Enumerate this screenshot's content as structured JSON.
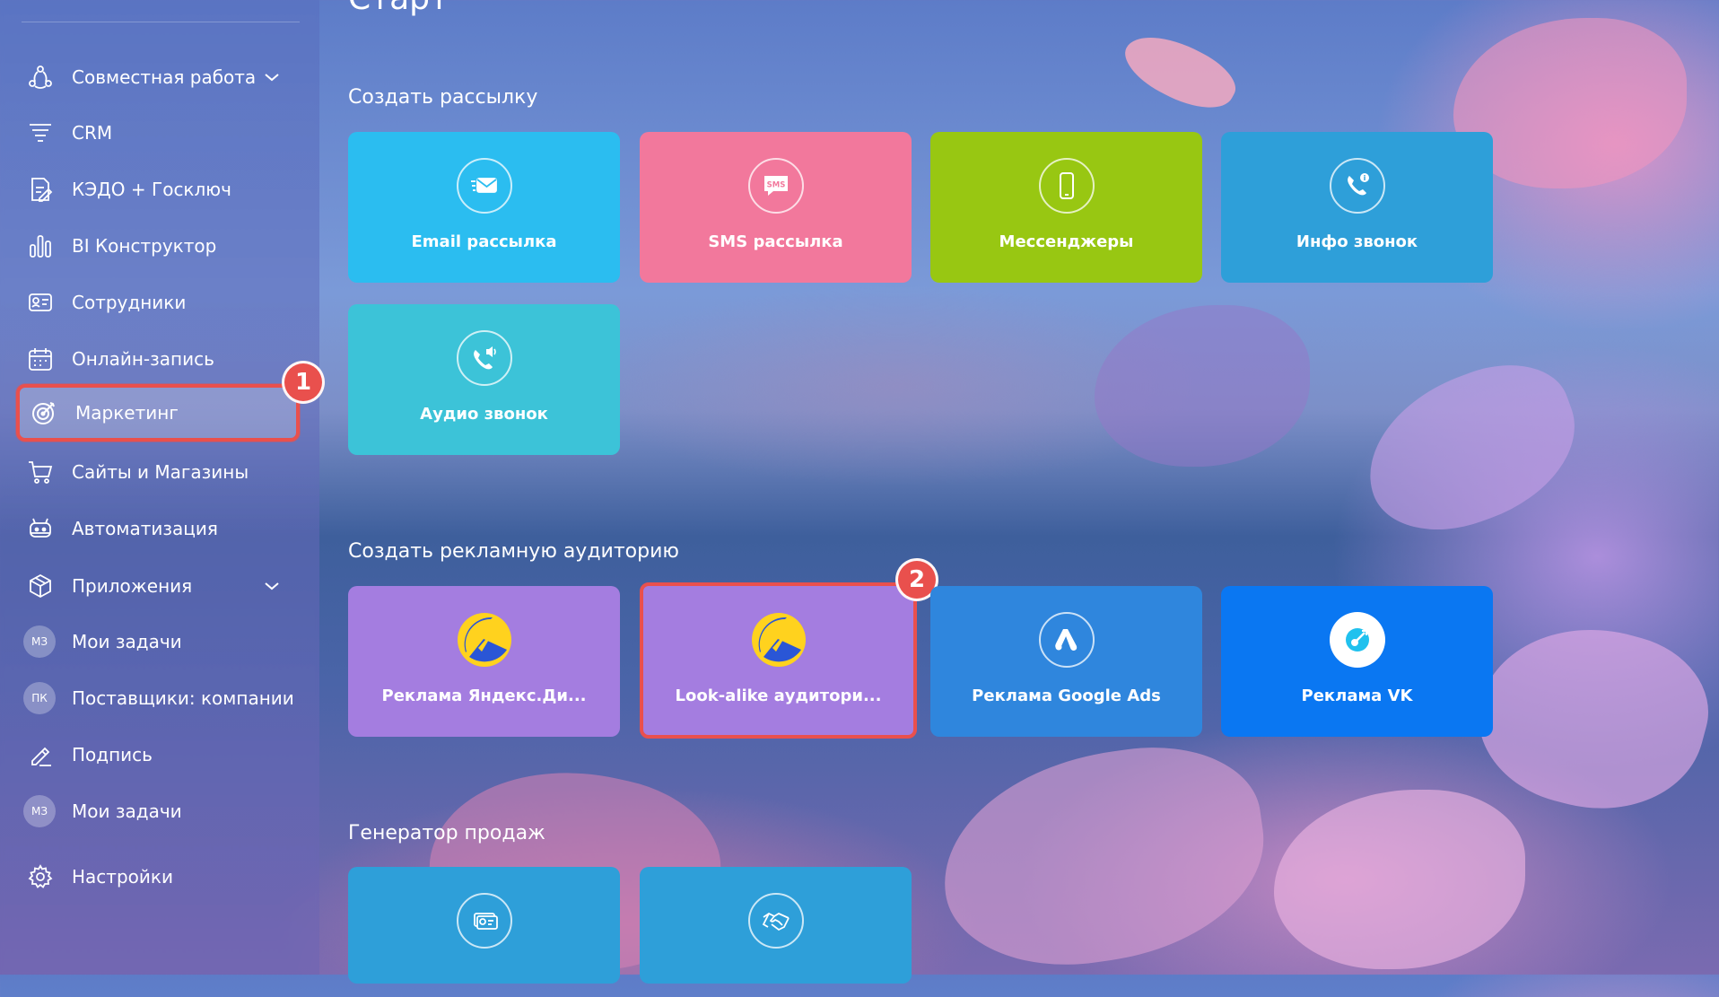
{
  "page": {
    "title": "Старт"
  },
  "sidebar": {
    "items": [
      {
        "label": "Совместная работа",
        "icon": "collaboration-icon",
        "has_chevron": true
      },
      {
        "label": "CRM",
        "icon": "crm-funnel-icon"
      },
      {
        "label": "КЭДО + Госключ",
        "icon": "document-sign-icon"
      },
      {
        "label": "BI Конструктор",
        "icon": "bar-chart-icon"
      },
      {
        "label": "Сотрудники",
        "icon": "id-card-icon"
      },
      {
        "label": "Онлайн-запись",
        "icon": "calendar-icon"
      },
      {
        "label": "Маркетинг",
        "icon": "target-icon",
        "active": true
      },
      {
        "label": "Сайты и Магазины",
        "icon": "cart-icon"
      },
      {
        "label": "Автоматизация",
        "icon": "robot-icon"
      },
      {
        "label": "Приложения",
        "icon": "cube-icon",
        "has_chevron": true
      },
      {
        "label": "Мои задачи",
        "avatar": "МЗ"
      },
      {
        "label": "Поставщики: компании",
        "avatar": "ПК"
      },
      {
        "label": "Подпись",
        "icon": "signature-icon"
      },
      {
        "label": "Мои задачи",
        "avatar": "МЗ"
      },
      {
        "label": "Настройки",
        "icon": "gear-icon"
      }
    ]
  },
  "badges": {
    "step1": "1",
    "step2": "2"
  },
  "sections": {
    "mailing": {
      "title": "Создать рассылку",
      "tiles": [
        {
          "label": "Email рассылка",
          "color": "#2bbdf0",
          "icon": "email-icon"
        },
        {
          "label": "SMS рассылка",
          "color": "#f2789c",
          "icon": "sms-icon"
        },
        {
          "label": "Мессенджеры",
          "color": "#98c712",
          "icon": "phone-icon"
        },
        {
          "label": "Инфо звонок",
          "color": "#2e9fd9",
          "icon": "info-call-icon"
        },
        {
          "label": "Аудио звонок",
          "color": "#3cc3d8",
          "icon": "audio-call-icon"
        }
      ]
    },
    "audience": {
      "title": "Создать рекламную аудиторию",
      "tiles": [
        {
          "label": "Реклама Яндекс.Ди...",
          "color": "#a47de0",
          "icon": "yandex-direct-icon"
        },
        {
          "label": "Look-alike аудитори...",
          "color": "#a47de0",
          "icon": "yandex-direct-icon",
          "highlighted": true
        },
        {
          "label": "Реклама Google Ads",
          "color": "#2f86dd",
          "icon": "google-ads-icon"
        },
        {
          "label": "Реклама VK",
          "color": "#0a77f2",
          "icon": "vk-ads-icon"
        }
      ]
    },
    "sales": {
      "title": "Генератор продаж",
      "tiles": [
        {
          "label": "",
          "color": "#2e9fd9",
          "icon": "id-money-icon"
        },
        {
          "label": "",
          "color": "#2e9fd9",
          "icon": "handshake-icon"
        }
      ]
    }
  }
}
